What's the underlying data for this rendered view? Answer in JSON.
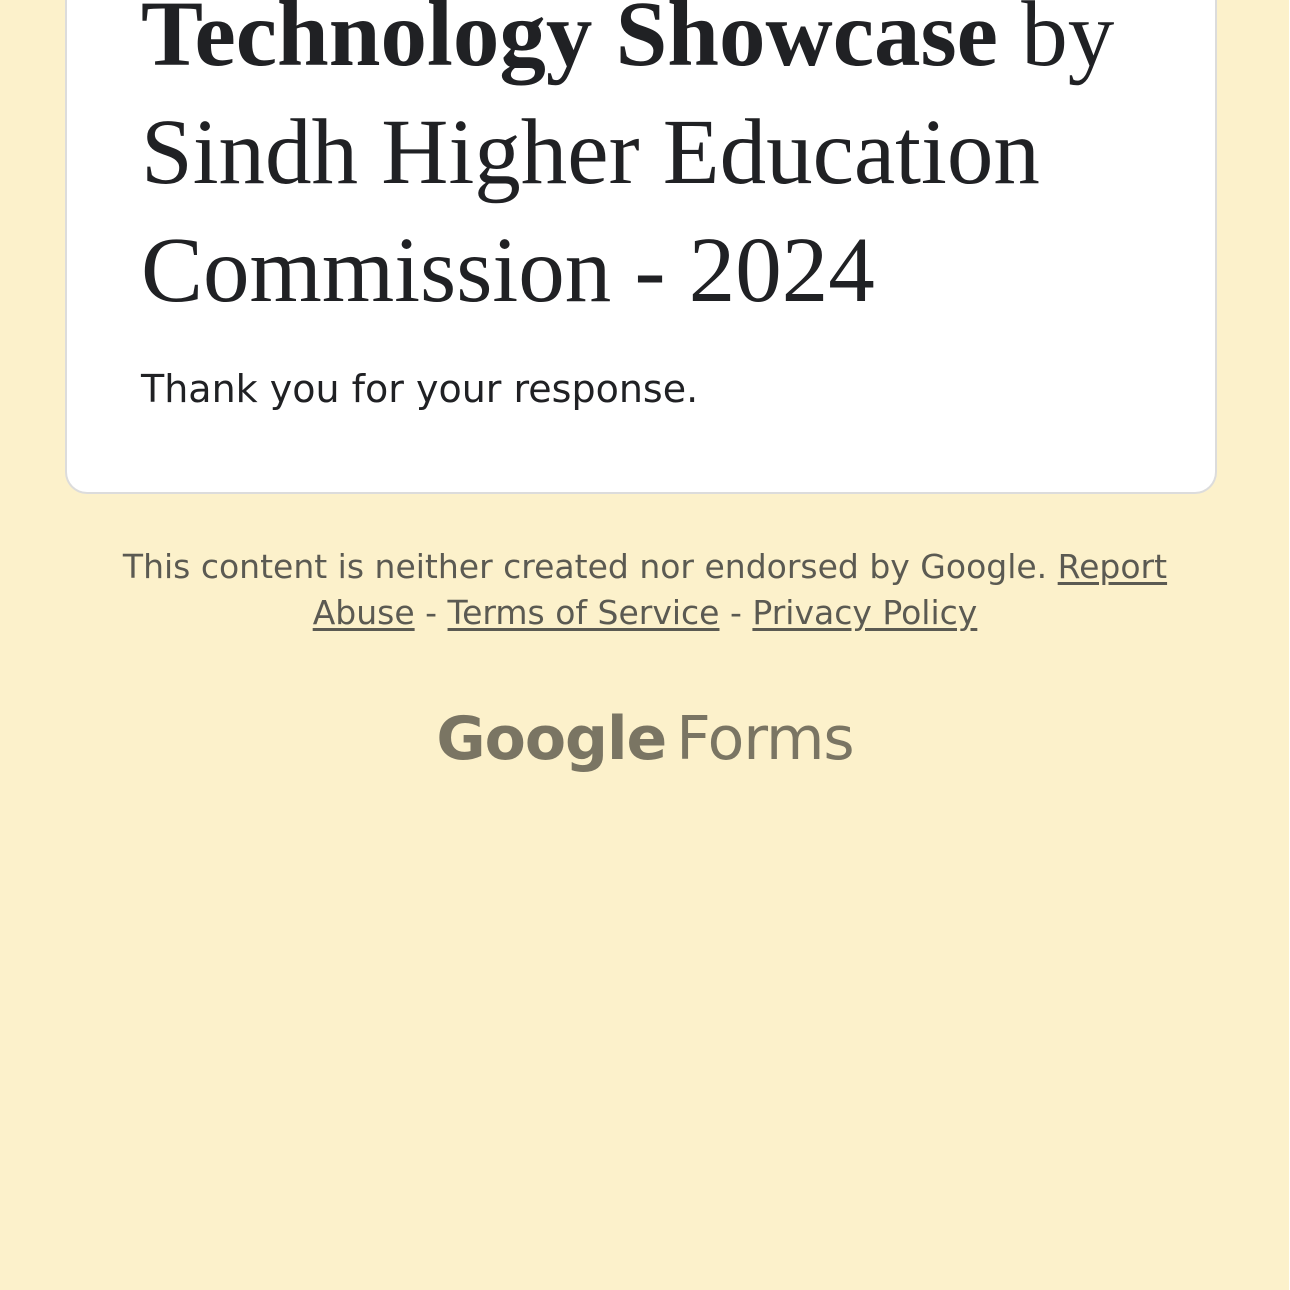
{
  "form": {
    "title_line_1_bold": "Technology Showcase",
    "title_line_1_rest": " by",
    "title_line_2": "Sindh Higher Education",
    "title_line_3": "Commission - 2024",
    "confirmation_message": "Thank you for your response."
  },
  "footer": {
    "disclaimer": "This content is neither created nor endorsed by Google.",
    "report_link_part_1": "Report",
    "report_link_part_2": "Abuse",
    "separator": "-",
    "terms_link": "Terms of Service",
    "privacy_link": "Privacy Policy"
  },
  "branding": {
    "logo_text": "Google",
    "product_text": "Forms"
  },
  "colors": {
    "page_background": "#fcf1cb",
    "card_background": "#ffffff",
    "text_primary": "#202124",
    "footer_text": "#5b5a52",
    "logo_color": "#7a7563"
  }
}
